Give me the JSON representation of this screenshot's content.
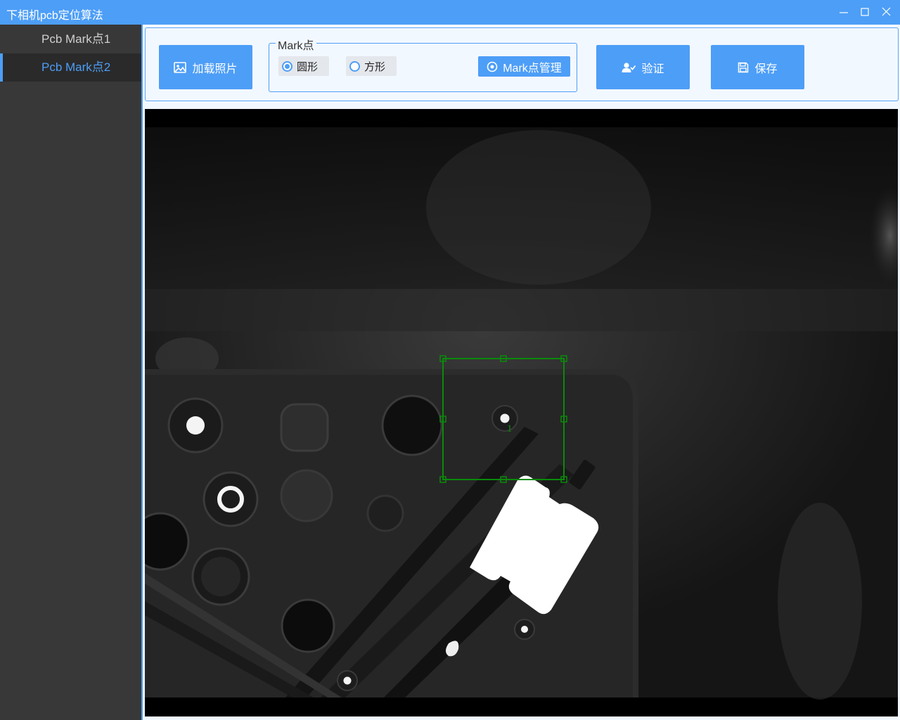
{
  "window": {
    "title": "下相机pcb定位算法",
    "controls": {
      "minimize": "minimize-icon",
      "maximize": "maximize-icon",
      "close": "close-icon"
    }
  },
  "sidebar": {
    "items": [
      {
        "label": "Pcb Mark点1",
        "active": false
      },
      {
        "label": "Pcb Mark点2",
        "active": true
      }
    ]
  },
  "toolbar": {
    "load_photo_label": "加载照片",
    "load_photo_icon": "image-icon",
    "mark_group": {
      "legend": "Mark点",
      "options": [
        {
          "label": "圆形",
          "checked": true
        },
        {
          "label": "方形",
          "checked": false
        }
      ],
      "manage_label": "Mark点管理",
      "manage_icon": "target-icon"
    },
    "verify_label": "验证",
    "verify_icon": "user-check-icon",
    "save_label": "保存",
    "save_icon": "floppy-disk-icon"
  },
  "viewer": {
    "roi_label": "1",
    "roi_color": "#0a8a0a"
  },
  "colors": {
    "accent": "#4d9ef7",
    "sidebar_bg": "#383838",
    "sidebar_active_bg": "#2a2a2a",
    "toolbar_bg": "#f2f8ff"
  }
}
